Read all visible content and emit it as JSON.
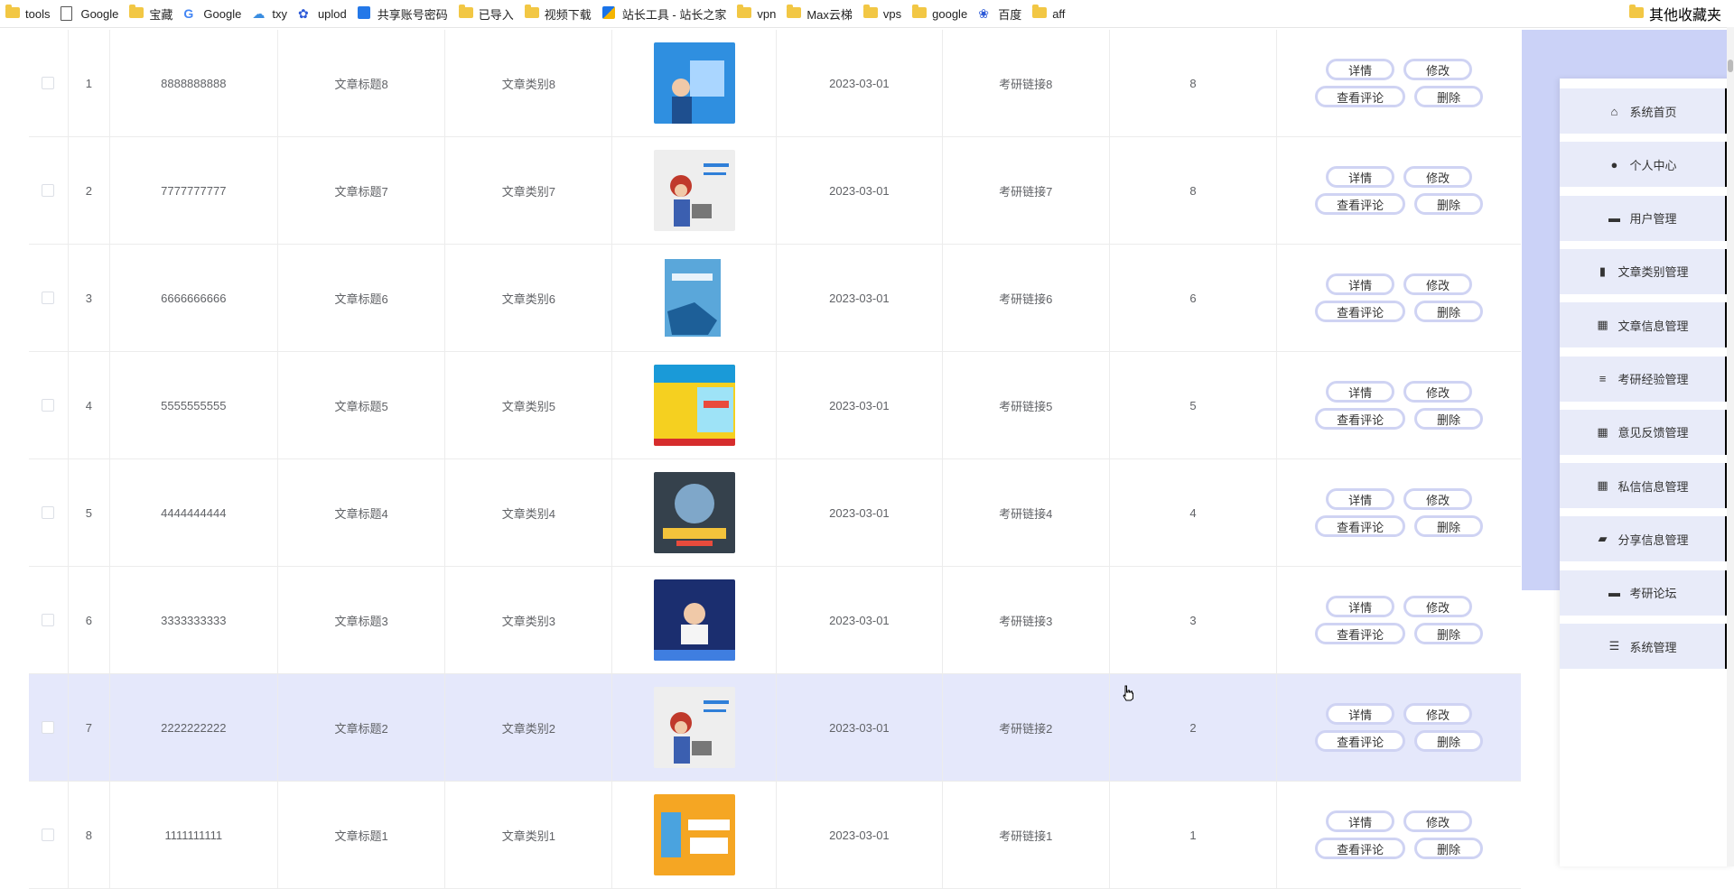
{
  "bookmarks": [
    {
      "label": "tools",
      "icon": "folder-icon"
    },
    {
      "label": "Google",
      "icon": "page-icon"
    },
    {
      "label": "宝藏",
      "icon": "folder-icon"
    },
    {
      "label": "Google",
      "icon": "google-icon"
    },
    {
      "label": "txy",
      "icon": "cloud-icon"
    },
    {
      "label": "uplod",
      "icon": "paw-icon"
    },
    {
      "label": "共享账号密码",
      "icon": "share-icon"
    },
    {
      "label": "已导入",
      "icon": "folder-icon"
    },
    {
      "label": "视频下载",
      "icon": "folder-icon"
    },
    {
      "label": "站长工具 - 站长之家",
      "icon": "zz-icon"
    },
    {
      "label": "vpn",
      "icon": "folder-icon"
    },
    {
      "label": "Max云梯",
      "icon": "folder-icon"
    },
    {
      "label": "vps",
      "icon": "folder-icon"
    },
    {
      "label": "google",
      "icon": "folder-icon"
    },
    {
      "label": "百度",
      "icon": "baidu-icon"
    },
    {
      "label": "aff",
      "icon": "folder-icon"
    }
  ],
  "other_bookmarks": "其他收藏夹",
  "ops": {
    "detail": "详情",
    "edit": "修改",
    "comments": "查看评论",
    "delete": "删除"
  },
  "rows": [
    {
      "index": "1",
      "code": "8888888888",
      "title": "文章标题8",
      "category": "文章类别8",
      "date": "2023-03-01",
      "link": "考研链接8",
      "count": "8",
      "thumb": "blue-illustration"
    },
    {
      "index": "2",
      "code": "7777777777",
      "title": "文章标题7",
      "category": "文章类别7",
      "date": "2023-03-01",
      "link": "考研链接7",
      "count": "8",
      "thumb": "girl-laptop"
    },
    {
      "index": "3",
      "code": "6666666666",
      "title": "文章标题6",
      "category": "文章类别6",
      "date": "2023-03-01",
      "link": "考研链接6",
      "count": "6",
      "thumb": "python-book"
    },
    {
      "index": "4",
      "code": "5555555555",
      "title": "文章标题5",
      "category": "文章类别5",
      "date": "2023-03-01",
      "link": "考研链接5",
      "count": "5",
      "thumb": "scratch-book"
    },
    {
      "index": "5",
      "code": "4444444444",
      "title": "文章标题4",
      "category": "文章类别4",
      "date": "2023-03-01",
      "link": "考研链接4",
      "count": "4",
      "thumb": "shark-book"
    },
    {
      "index": "6",
      "code": "3333333333",
      "title": "文章标题3",
      "category": "文章类别3",
      "date": "2023-03-01",
      "link": "考研链接3",
      "count": "3",
      "thumb": "coder-blue"
    },
    {
      "index": "7",
      "code": "2222222222",
      "title": "文章标题2",
      "category": "文章类别2",
      "date": "2023-03-01",
      "link": "考研链接2",
      "count": "2",
      "thumb": "girl-laptop"
    },
    {
      "index": "8",
      "code": "1111111111",
      "title": "文章标题1",
      "category": "文章类别1",
      "date": "2023-03-01",
      "link": "考研链接1",
      "count": "1",
      "thumb": "orange-robot"
    }
  ],
  "highlight_row": 7,
  "sidebar": [
    {
      "label": "系统首页",
      "icon": "home-icon"
    },
    {
      "label": "个人中心",
      "icon": "user-icon"
    },
    {
      "label": "用户管理",
      "icon": "users-icon"
    },
    {
      "label": "文章类别管理",
      "icon": "clipboard-icon"
    },
    {
      "label": "文章信息管理",
      "icon": "grid-icon"
    },
    {
      "label": "考研经验管理",
      "icon": "sliders-icon"
    },
    {
      "label": "意见反馈管理",
      "icon": "apps-icon"
    },
    {
      "label": "私信信息管理",
      "icon": "grid-icon"
    },
    {
      "label": "分享信息管理",
      "icon": "ticket-icon"
    },
    {
      "label": "考研论坛",
      "icon": "monitor-icon"
    },
    {
      "label": "系统管理",
      "icon": "menu-icon"
    }
  ],
  "colors": {
    "accent": "#cbd2f7",
    "row_highlight": "#e5e8fb",
    "button_border": "#cfd3f3",
    "nav_bg": "#e8ebf9"
  }
}
